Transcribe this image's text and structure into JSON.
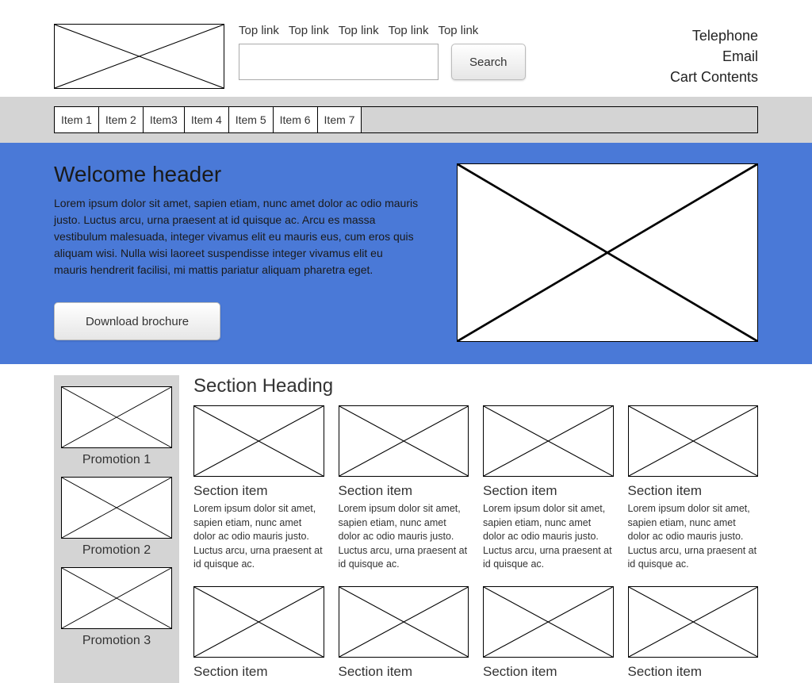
{
  "header": {
    "top_links": [
      "Top link",
      "Top link",
      "Top link",
      "Top link",
      "Top link"
    ],
    "search_button": "Search",
    "right": {
      "telephone": "Telephone",
      "email": "Email",
      "cart": "Cart Contents"
    }
  },
  "nav": [
    "Item 1",
    "Item 2",
    "Item3",
    "Item 4",
    "Item 5",
    "Item 6",
    "Item 7"
  ],
  "hero": {
    "title": "Welcome header",
    "text": "Lorem ipsum dolor sit amet, sapien etiam, nunc amet dolor ac odio mauris justo. Luctus arcu, urna praesent at id quisque ac. Arcu es massa vestibulum malesuada, integer vivamus elit eu mauris eus, cum eros quis aliquam wisi. Nulla wisi laoreet suspendisse integer vivamus elit eu mauris hendrerit facilisi, mi mattis pariatur aliquam pharetra eget.",
    "button": "Download brochure"
  },
  "sidebar": {
    "promotions": [
      "Promotion 1",
      "Promotion 2",
      "Promotion 3"
    ]
  },
  "section": {
    "heading": "Section Heading",
    "item_title": "Section item",
    "item_text": "Lorem ipsum dolor sit amet, sapien etiam, nunc amet dolor ac odio mauris justo. Luctus arcu, urna praesent at id quisque ac."
  }
}
